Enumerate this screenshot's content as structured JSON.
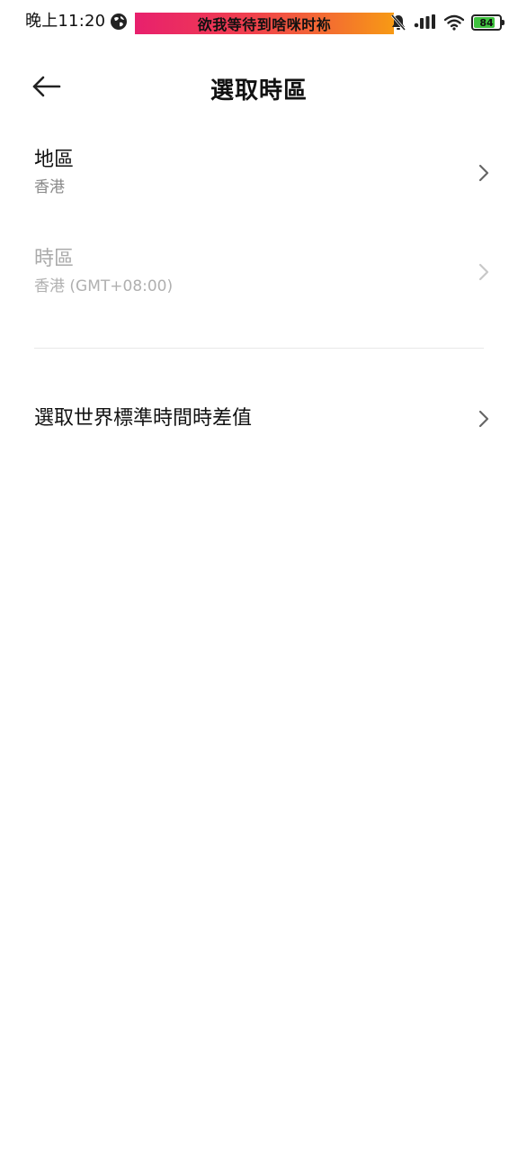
{
  "status_bar": {
    "time": "晚上11:20",
    "banner_text": "欲我等待到啥咪时袮",
    "battery_level": "84",
    "icons": [
      "globe-icon",
      "mute-bell-icon",
      "signal-icon",
      "wifi-icon",
      "battery-icon"
    ]
  },
  "header": {
    "title": "選取時區",
    "back_icon": "arrow-left-icon"
  },
  "items": [
    {
      "title": "地區",
      "subtitle": "香港",
      "enabled": true
    },
    {
      "title": "時區",
      "subtitle": "香港 (GMT+08:00)",
      "enabled": false
    },
    {
      "title": "選取世界標準時間時差值",
      "enabled": true
    }
  ],
  "colors": {
    "banner_start": "#e8206d",
    "banner_end": "#f79a14",
    "battery_fill": "#3fc23f",
    "text_primary": "#111111",
    "text_secondary": "#888888",
    "text_disabled": "#aaaaaa"
  }
}
